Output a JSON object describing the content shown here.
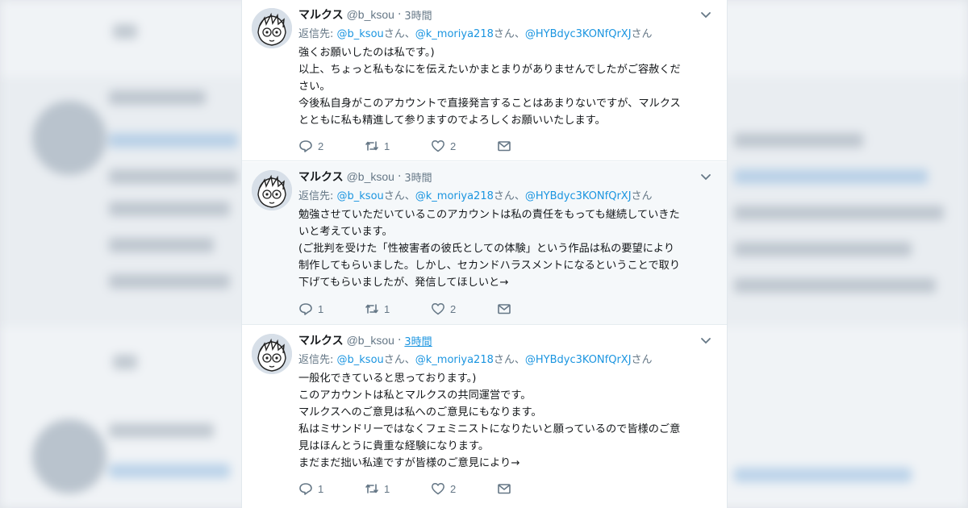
{
  "tweets": [
    {
      "name": "マルクス",
      "handle": "@b_ksou",
      "separator": "·",
      "time": "3時間",
      "reply_label": "返信先: ",
      "mentions": [
        "@b_ksou",
        "@k_moriya218",
        "@HYBdyc3KONfQrXJ"
      ],
      "suffixes": [
        "さん、",
        "さん、",
        "さん"
      ],
      "lines": [
        "強くお願いしたのは私です。)",
        "以上、ちょっと私もなにを伝えたいかまとまりがありませんでしたがご容赦くだ",
        "さい。",
        "今後私自身がこのアカウントで直接発言することはあまりないですが、マルクス",
        "とともに私も精進して参りますのでよろしくお願いいたします。"
      ],
      "reply_count": "2",
      "retweet_count": "1",
      "like_count": "2"
    },
    {
      "name": "マルクス",
      "handle": "@b_ksou",
      "separator": "·",
      "time": "3時間",
      "reply_label": "返信先: ",
      "mentions": [
        "@b_ksou",
        "@k_moriya218",
        "@HYBdyc3KONfQrXJ"
      ],
      "suffixes": [
        "さん、",
        "さん、",
        "さん"
      ],
      "lines": [
        "勉強させていただいているこのアカウントは私の責任をもっても継続していきた",
        "いと考えています。",
        "(ご批判を受けた「性被害者の彼氏としての体験」という作品は私の要望により",
        "制作してもらいました。しかし、セカンドハラスメントになるということで取り",
        "下げてもらいましたが、発信してほしいと→"
      ],
      "reply_count": "1",
      "retweet_count": "1",
      "like_count": "2"
    },
    {
      "name": "マルクス",
      "handle": "@b_ksou",
      "separator": "·",
      "time": "3時間",
      "reply_label": "返信先: ",
      "mentions": [
        "@b_ksou",
        "@k_moriya218",
        "@HYBdyc3KONfQrXJ"
      ],
      "suffixes": [
        "さん、",
        "さん、",
        "さん"
      ],
      "lines": [
        "一般化できていると思っております。)",
        "このアカウントは私とマルクスの共同運営です。",
        "マルクスへのご意見は私へのご意見にもなります。",
        "私はミサンドリーではなくフェミニストになりたいと願っているので皆様のご意",
        "見はほんとうに貴重な経験になります。",
        "まだまだ拙い私達ですが皆様のご意見により→"
      ],
      "reply_count": "1",
      "retweet_count": "1",
      "like_count": "2"
    }
  ],
  "colors": {
    "link_blue": "#1b95e0",
    "text_primary": "#14171a",
    "text_secondary": "#657786",
    "highlight_bg": "#f5f8fa"
  },
  "icons": {
    "reply": "reply-icon",
    "retweet": "retweet-icon",
    "like": "heart-icon",
    "dm": "envelope-icon",
    "menu": "chevron-down-icon"
  }
}
